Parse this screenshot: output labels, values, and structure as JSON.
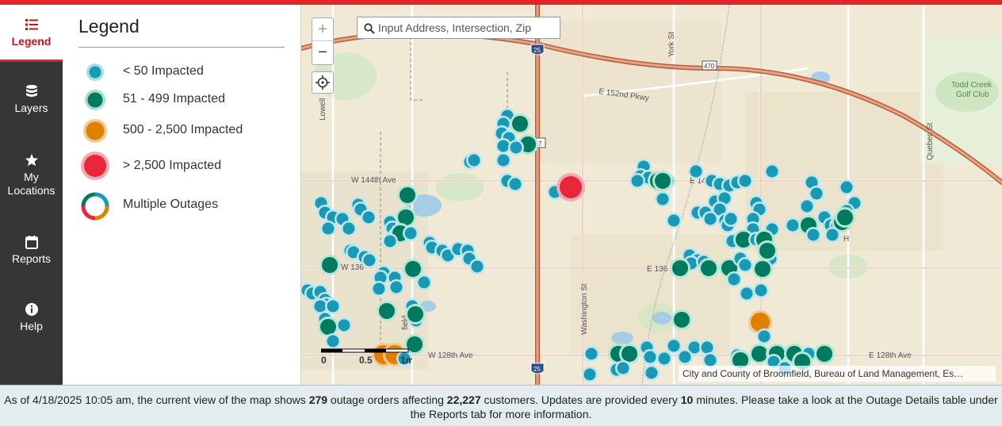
{
  "nav": {
    "items": [
      {
        "label": "Legend",
        "icon": "list-icon",
        "active": true
      },
      {
        "label": "Layers",
        "icon": "layers-icon"
      },
      {
        "label": "My Locations",
        "icon": "star-icon"
      },
      {
        "label": "Reports",
        "icon": "calendar-icon"
      },
      {
        "label": "Help",
        "icon": "info-icon"
      }
    ]
  },
  "legend": {
    "title": "Legend",
    "items": [
      {
        "label": "< 50 Impacted",
        "color": "#1899b6",
        "halo": "#a8dde6"
      },
      {
        "label": "51 - 499 Impacted",
        "color": "#007b5f",
        "halo": "#a8e0cd"
      },
      {
        "label": "500 - 2,500 Impacted",
        "color": "#e08000",
        "halo": "#f3c892"
      },
      {
        "label": "> 2,500 Impacted",
        "color": "#e8283a",
        "halo": "#f5a9b1"
      },
      {
        "label": "Multiple Outages",
        "colors": [
          "#1899b6",
          "#007b5f",
          "#e08000",
          "#e8283a"
        ]
      }
    ]
  },
  "map": {
    "search_placeholder": "Input Address, Intersection, Zip",
    "zoom_in": "+",
    "zoom_out": "−",
    "attribution": "City and County of Broomfield, Bureau of Land Management, Es…",
    "scale": {
      "start": "0",
      "mid": "0.5",
      "unit": "1mi"
    },
    "labels": {
      "e152": "E 152nd Pkwy",
      "w144": "W 144th Ave",
      "w136": "W 136",
      "e136": "E 136",
      "w128": "W 128th Ave",
      "e128": "E 128th Ave",
      "york": "York St",
      "washington": "Washington St",
      "quebec": "Quebec St",
      "lowell": "Lowell",
      "field": "field",
      "golf1": "Todd Creek",
      "golf2": "Golf Club",
      "e144": "E 14",
      "i25a": "25",
      "i25b": "25",
      "h470": "470",
      "h7": "7",
      "h": "H"
    }
  },
  "footer": {
    "p1": "As of 4/18/2025 10:05 am, the current view of the map shows ",
    "orders": "279",
    "p2": " outage orders affecting ",
    "customers": "22,227",
    "p3": " customers. Updates are provided every ",
    "minutes": "10",
    "p4": " minutes. Please take a look at the Outage Details table under the Reports tab for more information."
  },
  "colors": {
    "accent_red": "#e3242b",
    "sidebar_bg": "#363636",
    "footer_bg": "#e3ecef"
  }
}
